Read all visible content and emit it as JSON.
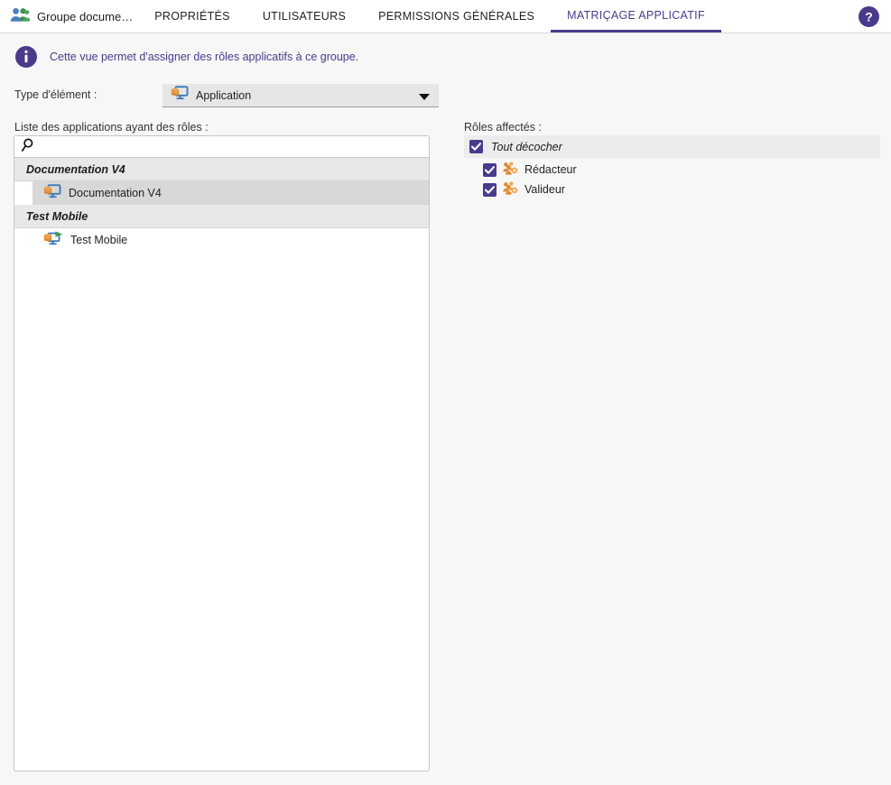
{
  "window": {
    "background_color": "#f7f7f7",
    "accent_color": "#4a3a8c"
  },
  "topbar": {
    "group_icon_name": "group-people-icon",
    "group_title": "Groupe docume…",
    "help_icon_name": "help-circle-icon",
    "tabs": [
      {
        "label": "PROPRIÉTÉS",
        "active": false
      },
      {
        "label": "UTILISATEURS",
        "active": false
      },
      {
        "label": "PERMISSIONS GÉNÉRALES",
        "active": false
      },
      {
        "label": "MATRIÇAGE APPLICATIF",
        "active": true
      }
    ]
  },
  "info_banner": {
    "icon_name": "info-circle-icon",
    "text": "Cette vue permet d'assigner des rôles applicatifs à ce groupe.",
    "color": "#4a3a8c"
  },
  "type_selector": {
    "label": "Type d'élément :",
    "selected_value": "Application",
    "icon_name": "application-icon",
    "arrow_icon_name": "chevron-down-icon",
    "options": [
      "Application"
    ]
  },
  "apps_panel": {
    "heading": "Liste des applications ayant des rôles :",
    "search": {
      "icon_name": "search-icon",
      "value": "",
      "placeholder": ""
    },
    "groups": [
      {
        "header": "Documentation V4",
        "items": [
          {
            "label": "Documentation V4",
            "icon_name": "application-icon",
            "selected": true
          }
        ]
      },
      {
        "header": "Test Mobile",
        "items": [
          {
            "label": "Test Mobile",
            "icon_name": "application-mobile-icon",
            "selected": false
          }
        ]
      }
    ]
  },
  "roles_panel": {
    "heading": "Rôles affectés :",
    "select_all": {
      "label": "Tout décocher",
      "checked": true
    },
    "roles": [
      {
        "label": "Rédacteur",
        "checked": true,
        "icon_name": "role-group-icon"
      },
      {
        "label": "Valideur",
        "checked": true,
        "icon_name": "role-group-icon"
      }
    ]
  }
}
